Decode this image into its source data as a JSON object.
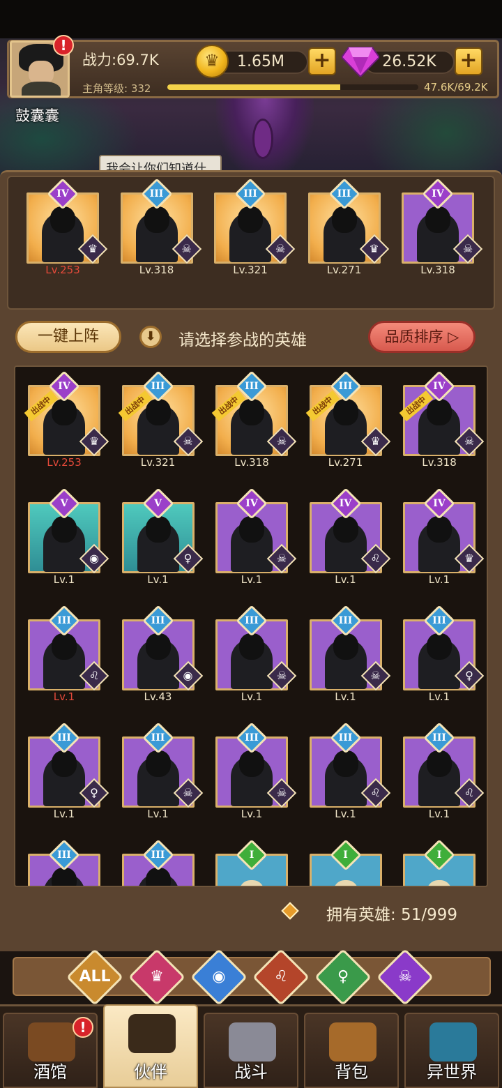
{
  "header": {
    "player_name": "鼓囊囊",
    "power": "战力:69.7K",
    "level_label": "主角等级: 332",
    "xp_text": "47.6K/69.2K",
    "xp_fraction": 0.688,
    "gold": "1.65M",
    "gems": "26.52K",
    "alert": "!",
    "speech": "我会让你们知道什"
  },
  "team": [
    {
      "grade": "IV",
      "level": "Lv.253",
      "bg": "gold",
      "red": true,
      "faction_color": "#4a2a6a",
      "faction": "♛"
    },
    {
      "grade": "III",
      "level": "Lv.318",
      "bg": "gold",
      "red": false,
      "faction_color": "#5a2a6a",
      "faction": "☠"
    },
    {
      "grade": "III",
      "level": "Lv.321",
      "bg": "gold",
      "red": false,
      "faction_color": "#5a2a6a",
      "faction": "☠"
    },
    {
      "grade": "III",
      "level": "Lv.271",
      "bg": "gold",
      "red": false,
      "faction_color": "#4a2a6a",
      "faction": "♛"
    },
    {
      "grade": "IV",
      "level": "Lv.318",
      "bg": "purple",
      "red": false,
      "faction_color": "#5a2a6a",
      "faction": "☠"
    }
  ],
  "controls": {
    "one_click": "一键上阵",
    "hint": "请选择参战的英雄",
    "sort": "品质排序",
    "sort_arrow": "▷",
    "owned": "拥有英雄: 51/999"
  },
  "deploy_tag": "出战中",
  "heroes": [
    {
      "grade": "IV",
      "level": "Lv.253",
      "bg": "gold",
      "red": true,
      "deployed": true,
      "faction": "♛"
    },
    {
      "grade": "III",
      "level": "Lv.321",
      "bg": "gold",
      "red": false,
      "deployed": true,
      "faction": "☠"
    },
    {
      "grade": "III",
      "level": "Lv.318",
      "bg": "gold",
      "red": false,
      "deployed": true,
      "faction": "☠"
    },
    {
      "grade": "III",
      "level": "Lv.271",
      "bg": "gold",
      "red": false,
      "deployed": true,
      "faction": "♛"
    },
    {
      "grade": "IV",
      "level": "Lv.318",
      "bg": "purple",
      "red": false,
      "deployed": true,
      "faction": "☠"
    },
    {
      "grade": "V",
      "level": "Lv.1",
      "bg": "teal",
      "red": false,
      "deployed": false,
      "faction": "◉"
    },
    {
      "grade": "V",
      "level": "Lv.1",
      "bg": "teal",
      "red": false,
      "deployed": false,
      "faction": "♀"
    },
    {
      "grade": "IV",
      "level": "Lv.1",
      "bg": "purple",
      "red": false,
      "deployed": false,
      "faction": "☠"
    },
    {
      "grade": "IV",
      "level": "Lv.1",
      "bg": "purple",
      "red": false,
      "deployed": false,
      "faction": "♌"
    },
    {
      "grade": "IV",
      "level": "Lv.1",
      "bg": "purple",
      "red": false,
      "deployed": false,
      "faction": "♛"
    },
    {
      "grade": "III",
      "level": "Lv.1",
      "bg": "purple",
      "red": true,
      "deployed": false,
      "faction": "♌"
    },
    {
      "grade": "III",
      "level": "Lv.43",
      "bg": "purple",
      "red": false,
      "deployed": false,
      "faction": "◉"
    },
    {
      "grade": "III",
      "level": "Lv.1",
      "bg": "purple",
      "red": false,
      "deployed": false,
      "faction": "☠"
    },
    {
      "grade": "III",
      "level": "Lv.1",
      "bg": "purple",
      "red": false,
      "deployed": false,
      "faction": "☠"
    },
    {
      "grade": "III",
      "level": "Lv.1",
      "bg": "purple",
      "red": false,
      "deployed": false,
      "faction": "♀"
    },
    {
      "grade": "III",
      "level": "Lv.1",
      "bg": "purple",
      "red": false,
      "deployed": false,
      "faction": "♀"
    },
    {
      "grade": "III",
      "level": "Lv.1",
      "bg": "purple",
      "red": false,
      "deployed": false,
      "faction": "☠"
    },
    {
      "grade": "III",
      "level": "Lv.1",
      "bg": "purple",
      "red": false,
      "deployed": false,
      "faction": "☠"
    },
    {
      "grade": "III",
      "level": "Lv.1",
      "bg": "purple",
      "red": false,
      "deployed": false,
      "faction": "♌"
    },
    {
      "grade": "III",
      "level": "Lv.1",
      "bg": "purple",
      "red": false,
      "deployed": false,
      "faction": "♌"
    },
    {
      "grade": "III",
      "level": "",
      "bg": "purple",
      "red": false,
      "deployed": false,
      "faction": ""
    },
    {
      "grade": "III",
      "level": "",
      "bg": "purple",
      "red": false,
      "deployed": false,
      "faction": ""
    },
    {
      "grade": "I",
      "level": "",
      "bg": "blue",
      "red": false,
      "deployed": false,
      "faction": ""
    },
    {
      "grade": "I",
      "level": "",
      "bg": "blue",
      "red": false,
      "deployed": false,
      "faction": ""
    },
    {
      "grade": "I",
      "level": "",
      "bg": "blue",
      "red": false,
      "deployed": false,
      "faction": ""
    }
  ],
  "grade_colors": {
    "I": "#3fae3a",
    "III": "#3a9ad6",
    "IV": "#9b3fc9",
    "V": "#9b3fc9"
  },
  "filters": [
    {
      "name": "all",
      "label": "ALL",
      "color": "#c98a2e",
      "icon": "all-icon"
    },
    {
      "name": "knight",
      "label": "♛",
      "color": "#c8396a",
      "icon": "knight-faction-icon"
    },
    {
      "name": "water",
      "label": "◉",
      "color": "#3a7fd6",
      "icon": "water-faction-icon"
    },
    {
      "name": "beast",
      "label": "♌",
      "color": "#b4452a",
      "icon": "lion-faction-icon"
    },
    {
      "name": "elf",
      "label": "♀",
      "color": "#3a9a4a",
      "icon": "elf-faction-icon"
    },
    {
      "name": "demon",
      "label": "☠",
      "color": "#8a3ac9",
      "icon": "demon-faction-icon"
    }
  ],
  "nav": [
    {
      "label": "酒馆",
      "icon": "tavern-icon",
      "color": "#7a4a22",
      "active": false,
      "alert": true
    },
    {
      "label": "伙伴",
      "icon": "partner-icon",
      "color": "#3a2a1a",
      "active": true,
      "alert": false
    },
    {
      "label": "战斗",
      "icon": "battle-icon",
      "color": "#8a8a96",
      "active": false,
      "alert": false
    },
    {
      "label": "背包",
      "icon": "bag-icon",
      "color": "#a66a2a",
      "active": false,
      "alert": false
    },
    {
      "label": "异世界",
      "icon": "portal-icon",
      "color": "#2a7a9a",
      "active": false,
      "alert": false
    }
  ]
}
